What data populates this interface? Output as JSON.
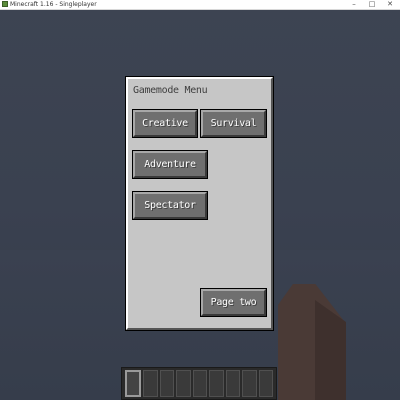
{
  "window": {
    "title": "Minecraft 1.16 - Singleplayer",
    "controls": [
      "–",
      "□",
      "✕"
    ]
  },
  "menu": {
    "title": "Gamemode Menu",
    "buttons": {
      "creative": "Creative",
      "survival": "Survival",
      "adventure": "Adventure",
      "spectator": "Spectator",
      "page_two": "Page two"
    }
  },
  "hotbar": {
    "slot_count": 9,
    "selected_slot": 1
  },
  "colors": {
    "sky": "#3b4250",
    "panel": "#c6c6c6",
    "button": "#6f6f6f",
    "button_text": "#ffffff",
    "pillar": "#4a3a36"
  }
}
